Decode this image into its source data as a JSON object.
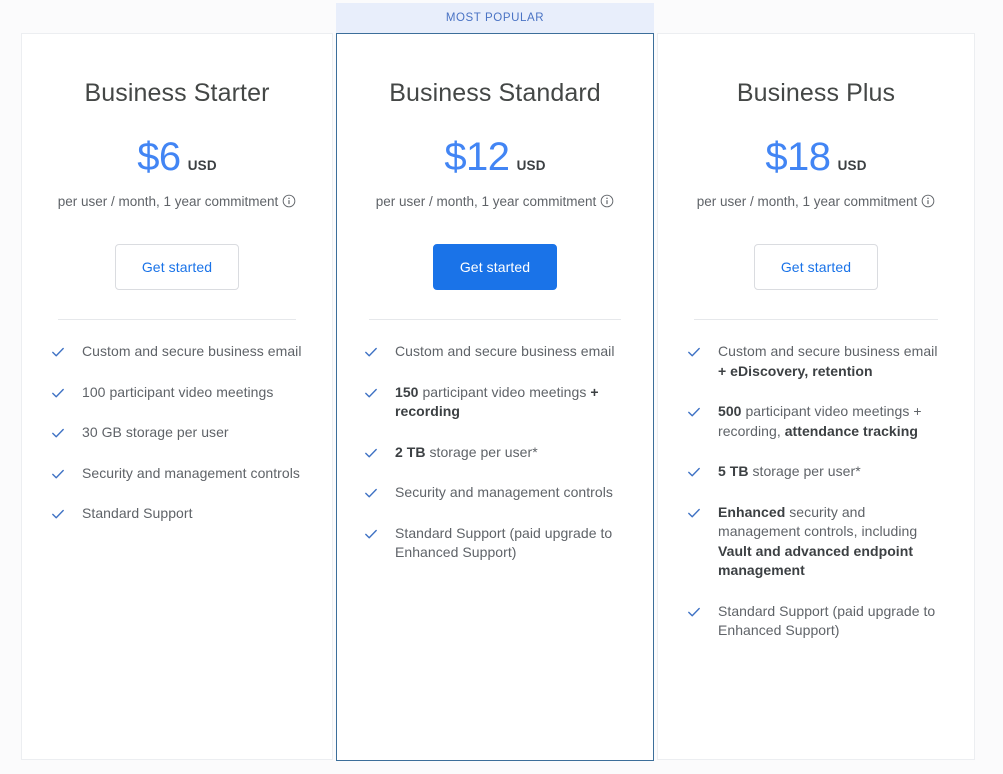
{
  "banner": {
    "label": "MOST POPULAR"
  },
  "colors": {
    "accent_blue": "#1a73e8",
    "price_blue": "#4285f4",
    "banner_bg": "#e8eefb",
    "banner_text": "#4a73c4",
    "featured_border": "#3c6e9a",
    "card_border": "#eceef1",
    "body_text": "#5f6368",
    "strong_text": "#3c4043",
    "page_bg": "#fbfbfc"
  },
  "icons": {
    "check": "check-icon",
    "info": "info-icon"
  },
  "plans": [
    {
      "id": "business-starter",
      "name": "Business Starter",
      "price": "$6",
      "currency": "USD",
      "note": "per user / month, 1 year commitment",
      "cta": "Get started",
      "featured": false,
      "features": [
        [
          {
            "t": "Custom and secure business email",
            "b": false
          }
        ],
        [
          {
            "t": "100 participant video meetings",
            "b": false
          }
        ],
        [
          {
            "t": "30 GB storage per user",
            "b": false
          }
        ],
        [
          {
            "t": "Security and management controls",
            "b": false
          }
        ],
        [
          {
            "t": "Standard Support",
            "b": false
          }
        ]
      ]
    },
    {
      "id": "business-standard",
      "name": "Business Standard",
      "price": "$12",
      "currency": "USD",
      "note": "per user / month, 1 year commitment",
      "cta": "Get started",
      "featured": true,
      "features": [
        [
          {
            "t": "Custom and secure business email",
            "b": false
          }
        ],
        [
          {
            "t": "150",
            "b": true
          },
          {
            "t": " participant video meetings ",
            "b": false
          },
          {
            "t": "+ recording",
            "b": true
          }
        ],
        [
          {
            "t": "2 TB",
            "b": true
          },
          {
            "t": " storage per user*",
            "b": false
          }
        ],
        [
          {
            "t": "Security and management controls",
            "b": false
          }
        ],
        [
          {
            "t": "Standard Support (paid upgrade to Enhanced Support)",
            "b": false
          }
        ]
      ]
    },
    {
      "id": "business-plus",
      "name": "Business Plus",
      "price": "$18",
      "currency": "USD",
      "note": "per user / month, 1 year commitment",
      "cta": "Get started",
      "featured": false,
      "features": [
        [
          {
            "t": "Custom and secure business email ",
            "b": false
          },
          {
            "t": "+ eDiscovery, retention",
            "b": true
          }
        ],
        [
          {
            "t": "500",
            "b": true
          },
          {
            "t": " participant video meetings + recording, ",
            "b": false
          },
          {
            "t": "attendance tracking",
            "b": true
          }
        ],
        [
          {
            "t": "5 TB",
            "b": true
          },
          {
            "t": " storage per user*",
            "b": false
          }
        ],
        [
          {
            "t": "Enhanced",
            "b": true
          },
          {
            "t": " security and management controls, including ",
            "b": false
          },
          {
            "t": "Vault and advanced endpoint management",
            "b": true
          }
        ],
        [
          {
            "t": "Standard Support (paid upgrade to Enhanced Support)",
            "b": false
          }
        ]
      ]
    }
  ]
}
